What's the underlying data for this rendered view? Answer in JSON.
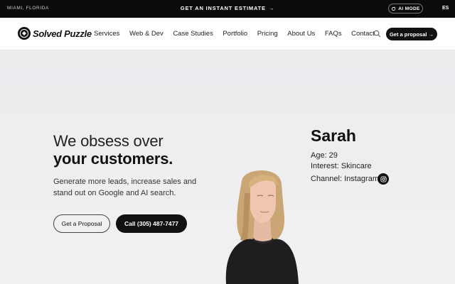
{
  "topbar": {
    "location": "MIAMI, FLORIDA",
    "estimate": "GET AN INSTANT ESTIMATE",
    "estimate_arrow": "→",
    "ai_mode": "AI MODE",
    "language": "ES"
  },
  "nav": {
    "logo_text": "Solved Puzzle",
    "items": [
      "Services",
      "Web & Dev",
      "Case Studies",
      "Portfolio",
      "Pricing",
      "About Us",
      "FAQs",
      "Contact"
    ],
    "cta": "Get a proposal →"
  },
  "hero": {
    "headline_light": "We obsess over",
    "headline_bold": "your customers.",
    "subtext": "Generate more leads, increase sales and stand out on Google and AI search.",
    "btn_secondary": "Get a Proposal",
    "btn_primary": "Call (305) 487-7477"
  },
  "persona": {
    "name": "Sarah",
    "age": "Age: 29",
    "interest": "Interest: Skincare",
    "channel": "Channel: Instagram"
  },
  "colors": {
    "brand_dark": "#111111",
    "hero_bg": "#eeeef1"
  }
}
